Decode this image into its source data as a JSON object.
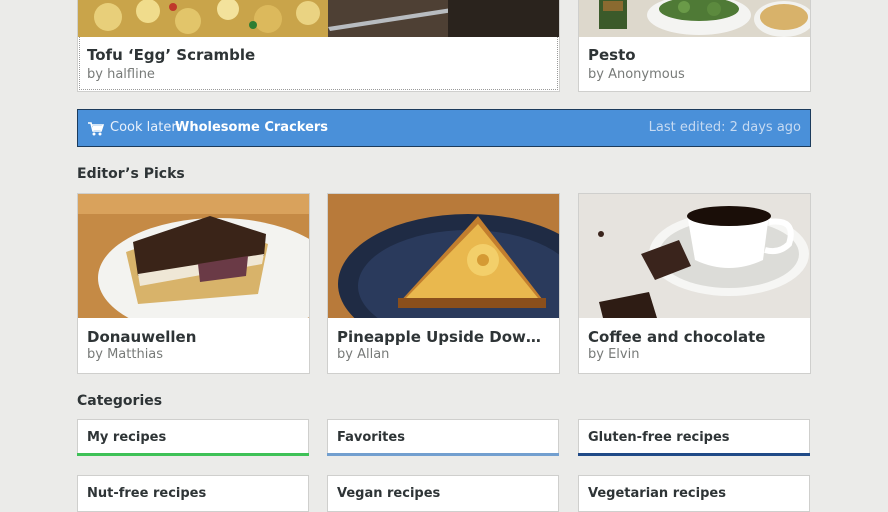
{
  "top_recipes": [
    {
      "title": "Tofu ‘Egg’ Scramble",
      "author": "by halfline"
    },
    {
      "title": "Pesto",
      "author": "by Anonymous"
    }
  ],
  "banner": {
    "prefix": "Cook later:",
    "recipe": "Wholesome Crackers",
    "edited": "Last edited: 2 days ago",
    "icon": "cart-icon",
    "color": "#4a90d9"
  },
  "editors_picks": {
    "heading": "Editor’s Picks",
    "items": [
      {
        "title": "Donauwellen",
        "author": "by Matthias"
      },
      {
        "title": "Pineapple Upside Down Cake ...",
        "author": "by Allan"
      },
      {
        "title": "Coffee and chocolate",
        "author": "by Elvin"
      }
    ]
  },
  "categories": {
    "heading": "Categories",
    "items": [
      {
        "label": "My recipes",
        "color": "#3ec157"
      },
      {
        "label": "Favorites",
        "color": "#729fcf"
      },
      {
        "label": "Gluten-free recipes",
        "color": "#204a87"
      },
      {
        "label": "Nut-free recipes",
        "color": "#cfcfcd"
      },
      {
        "label": "Vegan recipes",
        "color": "#cfcfcd"
      },
      {
        "label": "Vegetarian recipes",
        "color": "#cfcfcd"
      }
    ]
  }
}
